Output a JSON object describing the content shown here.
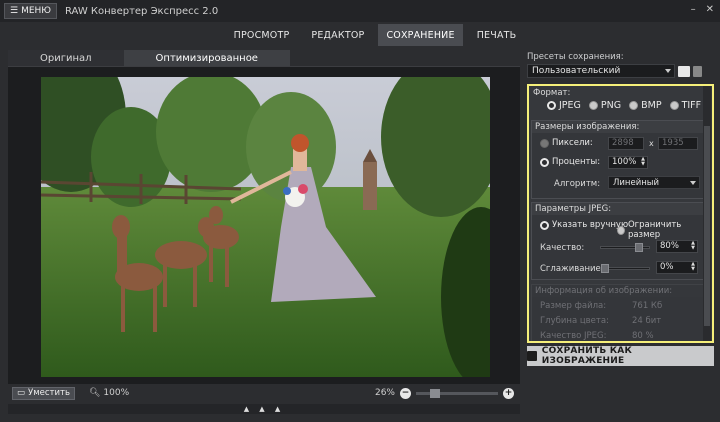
{
  "titlebar": {
    "menu_label": "МЕНЮ",
    "app_title": "RAW Конвертер Экспресс 2.0"
  },
  "nav": {
    "tabs": [
      "ПРОСМОТР",
      "РЕДАКТОР",
      "СОХРАНЕНИЕ",
      "ПЕЧАТЬ"
    ],
    "active": "СОХРАНЕНИЕ"
  },
  "viewer": {
    "tabs": [
      "Оригинал",
      "Оптимизированное"
    ],
    "active_tab": "Оптимизированное",
    "fit_label": "Уместить",
    "zoom_actual": "100%",
    "zoom_current": "26%"
  },
  "presets": {
    "label": "Пресеты сохранения:",
    "selected": "Пользовательский"
  },
  "format": {
    "title": "Формат:",
    "options": [
      "JPEG",
      "PNG",
      "BMP",
      "TIFF"
    ],
    "selected": "JPEG"
  },
  "size": {
    "title": "Размеры изображения:",
    "pixels_label": "Пиксели:",
    "width": "2898",
    "x_sep": "x",
    "height": "1935",
    "percent_label": "Проценты:",
    "percent_value": "100%",
    "algorithm_label": "Алгоритм:",
    "algorithm_value": "Линейный"
  },
  "jpeg": {
    "title": "Параметры JPEG:",
    "manual_label": "Указать вручную",
    "limit_label": "Ограничить размер",
    "quality_label": "Качество:",
    "quality_value": "80%",
    "quality_level": 0.8,
    "smoothing_label": "Сглаживание:",
    "smoothing_value": "0%",
    "smoothing_level": 0
  },
  "info": {
    "title": "Информация об изображении:",
    "rows": [
      {
        "label": "Размер файла:",
        "value": "761 Кб"
      },
      {
        "label": "Глубина цвета:",
        "value": "24 бит"
      },
      {
        "label": "Качество JPEG:",
        "value": "80 %"
      }
    ]
  },
  "save_button": "СОХРАНИТЬ КАК ИЗОБРАЖЕНИЕ",
  "bottom_arrows": "▲ ▲ ▲",
  "colors": {
    "highlight": "#f5ef7a",
    "background": "#2c2d30"
  }
}
